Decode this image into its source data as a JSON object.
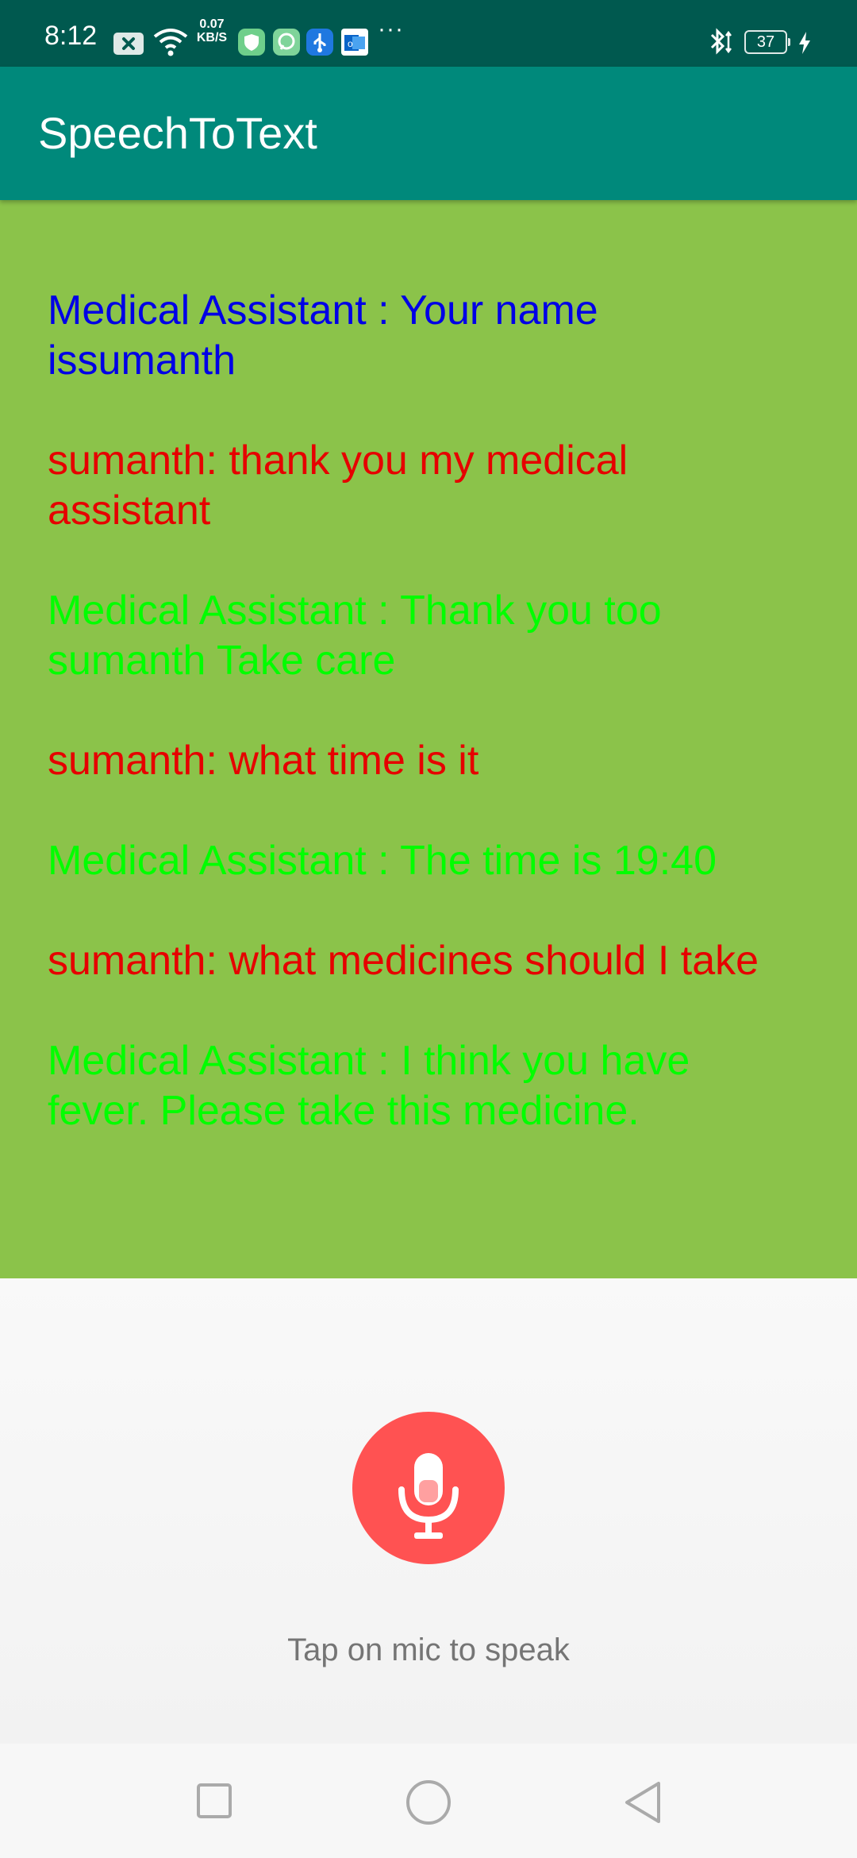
{
  "status_bar": {
    "time": "8:12",
    "net_speed_value": "0.07",
    "net_speed_unit": "KB/S",
    "battery_level": "37",
    "colors": {
      "background": "#00594f"
    },
    "icons": [
      "close-notification-icon",
      "wifi-icon",
      "shield-app-icon",
      "chat-app-icon",
      "usb-icon",
      "outlook-app-icon",
      "more-icon",
      "bluetooth-icon",
      "battery-icon",
      "charging-icon"
    ]
  },
  "app_bar": {
    "title": "SpeechToText",
    "colors": {
      "background": "#00897b",
      "text": "#ffffff"
    }
  },
  "conversation": {
    "background_color": "#8bc34a",
    "messages": [
      {
        "text": "Medical Assistant : Your name\nissumanth",
        "color": "#0000e6"
      },
      {
        "text": "sumanth: thank you my medical\nassistant",
        "color": "#e60000"
      },
      {
        "text": "Medical Assistant : Thank you too\nsumanth Take care",
        "color": "#00ff00"
      },
      {
        "text": "sumanth: what time is it",
        "color": "#e60000"
      },
      {
        "text": "Medical Assistant : The time is 19:40",
        "color": "#00ff00"
      },
      {
        "text": "sumanth: what medicines should I take",
        "color": "#e60000"
      },
      {
        "text": "Medical Assistant : I think you have\nfever. Please take this medicine.",
        "color": "#00ff00"
      }
    ]
  },
  "mic": {
    "icon": "microphone-icon",
    "button_color": "#ff5252",
    "hint": "Tap on mic to speak"
  },
  "nav_bar": {
    "icons": [
      "recent-apps-icon",
      "home-icon",
      "back-icon"
    ]
  }
}
